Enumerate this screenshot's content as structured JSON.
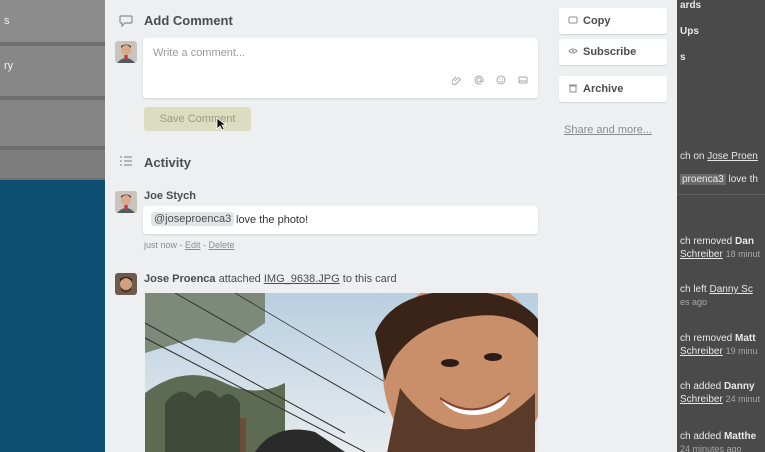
{
  "left_board": {
    "rows": [
      "s",
      "ry"
    ]
  },
  "right_board": {
    "lines": [
      {
        "text": "ards"
      },
      {
        "text": "Ups"
      },
      {
        "text": "s"
      }
    ],
    "activity": [
      {
        "prefix": "ch on ",
        "link": "Jose Proen"
      },
      {
        "prefix": "",
        "mention": "proenca3",
        "rest": " love th"
      },
      {
        "prefix": "ch removed ",
        "bold": "Dan",
        "line2": "Schreiber",
        "meta": "18 minut"
      },
      {
        "prefix": "ch left ",
        "link": "Danny Sc",
        "meta": "es ago"
      },
      {
        "prefix": "ch removed ",
        "bold": "Matt",
        "line2": "Schreiber",
        "meta": "19 minu"
      },
      {
        "prefix": "ch added ",
        "bold": "Danny",
        "line2": "Schreiber",
        "meta": "24 minut"
      },
      {
        "prefix": "ch added ",
        "bold": "Matthe",
        "meta": "24 minutes ago"
      }
    ]
  },
  "add_comment": {
    "title": "Add Comment",
    "placeholder": "Write a comment...",
    "icons": [
      "attachment-icon",
      "mention-icon",
      "emoji-icon",
      "card-icon"
    ],
    "save_label": "Save Comment"
  },
  "activity": {
    "title": "Activity",
    "comment": {
      "author": "Joe Stych",
      "mention": "@joseproenca3",
      "text": "love the photo!",
      "meta_time": "just now",
      "meta_sep1": " - ",
      "edit": "Edit",
      "meta_sep2": " - ",
      "delete": "Delete"
    },
    "attachment": {
      "author": "Jose Proenca",
      "action": " attached ",
      "file": "IMG_9638.JPG",
      "suffix": " to this card"
    }
  },
  "sidebar": {
    "copy": "Copy",
    "subscribe": "Subscribe",
    "archive": "Archive",
    "share": "Share and more..."
  },
  "colors": {
    "modal_bg": "#edeff0",
    "save_button": "#dcdcc0",
    "board_blue": "#0e4f73"
  }
}
